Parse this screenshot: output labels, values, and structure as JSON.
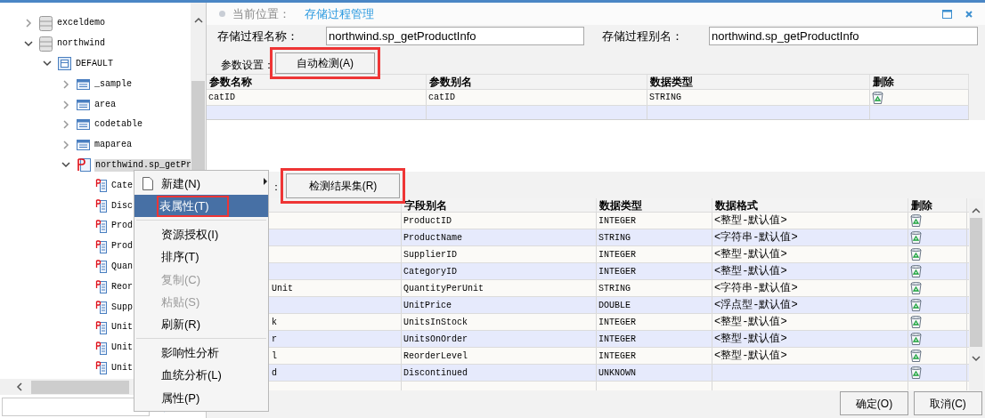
{
  "tree": {
    "items": [
      {
        "label": "exceldemo",
        "kind": "database",
        "expanded": false,
        "selected": false
      },
      {
        "label": "northwind",
        "kind": "database",
        "expanded": true,
        "selected": false,
        "children": [
          {
            "label": "DEFAULT",
            "kind": "schema",
            "expanded": true,
            "selected": false,
            "children": [
              {
                "label": "_sample",
                "kind": "table",
                "expanded": false,
                "selected": false
              },
              {
                "label": "area",
                "kind": "table",
                "expanded": false,
                "selected": false
              },
              {
                "label": "codetable",
                "kind": "table",
                "expanded": false,
                "selected": false
              },
              {
                "label": "maparea",
                "kind": "table",
                "expanded": false,
                "selected": false
              },
              {
                "label": "northwind.sp_getPr",
                "kind": "procedure",
                "expanded": true,
                "selected": true,
                "children": [
                  {
                    "label": "Cate",
                    "kind": "field",
                    "selected": false
                  },
                  {
                    "label": "Disc",
                    "kind": "field",
                    "selected": false
                  },
                  {
                    "label": "Prod",
                    "kind": "field",
                    "selected": false
                  },
                  {
                    "label": "Prod",
                    "kind": "field",
                    "selected": false
                  },
                  {
                    "label": "Quan",
                    "kind": "field",
                    "selected": false
                  },
                  {
                    "label": "Reor",
                    "kind": "field",
                    "selected": false
                  },
                  {
                    "label": "Supp",
                    "kind": "field",
                    "selected": false
                  },
                  {
                    "label": "Unit",
                    "kind": "field",
                    "selected": false
                  },
                  {
                    "label": "Unit",
                    "kind": "field",
                    "selected": false
                  },
                  {
                    "label": "Unit",
                    "kind": "field",
                    "selected": false
                  }
                ]
              }
            ]
          }
        ]
      }
    ]
  },
  "context_menu": {
    "items": [
      {
        "kind": "item",
        "label": "新建(N)",
        "submenu": true,
        "icon": true,
        "selected": false,
        "disabled": false,
        "highlighted": false
      },
      {
        "kind": "item",
        "label": "表属性(T)",
        "submenu": false,
        "icon": false,
        "selected": true,
        "disabled": false,
        "highlighted": true
      },
      {
        "kind": "separator"
      },
      {
        "kind": "item",
        "label": "资源授权(I)",
        "submenu": false,
        "icon": false,
        "selected": false,
        "disabled": false,
        "highlighted": false
      },
      {
        "kind": "item",
        "label": "排序(T)",
        "submenu": false,
        "icon": false,
        "selected": false,
        "disabled": false,
        "highlighted": false
      },
      {
        "kind": "item",
        "label": "复制(C)",
        "submenu": false,
        "icon": false,
        "selected": false,
        "disabled": true,
        "highlighted": false
      },
      {
        "kind": "item",
        "label": "粘贴(S)",
        "submenu": false,
        "icon": false,
        "selected": false,
        "disabled": true,
        "highlighted": false
      },
      {
        "kind": "item",
        "label": "刷新(R)",
        "submenu": false,
        "icon": false,
        "selected": false,
        "disabled": false,
        "highlighted": false
      },
      {
        "kind": "separator"
      },
      {
        "kind": "item",
        "label": "影响性分析",
        "submenu": false,
        "icon": false,
        "selected": false,
        "disabled": false,
        "highlighted": false
      },
      {
        "kind": "item",
        "label": "血统分析(L)",
        "submenu": false,
        "icon": false,
        "selected": false,
        "disabled": false,
        "highlighted": false
      },
      {
        "kind": "item",
        "label": "属性(P)",
        "submenu": false,
        "icon": false,
        "selected": false,
        "disabled": false,
        "highlighted": false
      }
    ]
  },
  "breadcrumb": {
    "label": "当前位置：",
    "value": "存储过程管理"
  },
  "form": {
    "name_label": "存储过程名称：",
    "name_value": "northwind.sp_getProductInfo",
    "alias_label": "存储过程别名：",
    "alias_value": "northwind.sp_getProductInfo"
  },
  "params": {
    "label": "参数设置：",
    "detect_button": {
      "label": "自动检测(A)",
      "highlighted": true
    },
    "columns": [
      "参数名称",
      "参数别名",
      "数据类型",
      "删除"
    ],
    "rows": [
      {
        "name": "catID",
        "alias": "catID",
        "type": "STRING"
      }
    ]
  },
  "result": {
    "label": "：",
    "detect_button": {
      "label": "检测结果集(R)",
      "highlighted": true
    },
    "columns": [
      "字段别名",
      "数据类型",
      "数据格式",
      "删除"
    ],
    "rows": [
      {
        "alias": "ProductID",
        "type": "INTEGER",
        "format": "<整型-默认值>"
      },
      {
        "alias": "ProductName",
        "type": "STRING",
        "format": "<字符串-默认值>"
      },
      {
        "alias": "SupplierID",
        "type": "INTEGER",
        "format": "<整型-默认值>"
      },
      {
        "alias": "CategoryID",
        "type": "INTEGER",
        "format": "<整型-默认值>"
      },
      {
        "column_1": "Unit",
        "alias": "QuantityPerUnit",
        "type": "STRING",
        "format": "<字符串-默认值>"
      },
      {
        "alias": "UnitPrice",
        "type": "DOUBLE",
        "format": "<浮点型-默认值>"
      },
      {
        "column_1": "k",
        "alias": "UnitsInStock",
        "type": "INTEGER",
        "format": "<整型-默认值>"
      },
      {
        "column_1": "r",
        "alias": "UnitsOnOrder",
        "type": "INTEGER",
        "format": "<整型-默认值>"
      },
      {
        "column_1": "l",
        "alias": "ReorderLevel",
        "type": "INTEGER",
        "format": "<整型-默认值>"
      },
      {
        "column_1": "d",
        "alias": "Discontinued",
        "type": "UNKNOWN"
      }
    ]
  },
  "buttons": [
    "确定(O)",
    "取消(C)"
  ]
}
